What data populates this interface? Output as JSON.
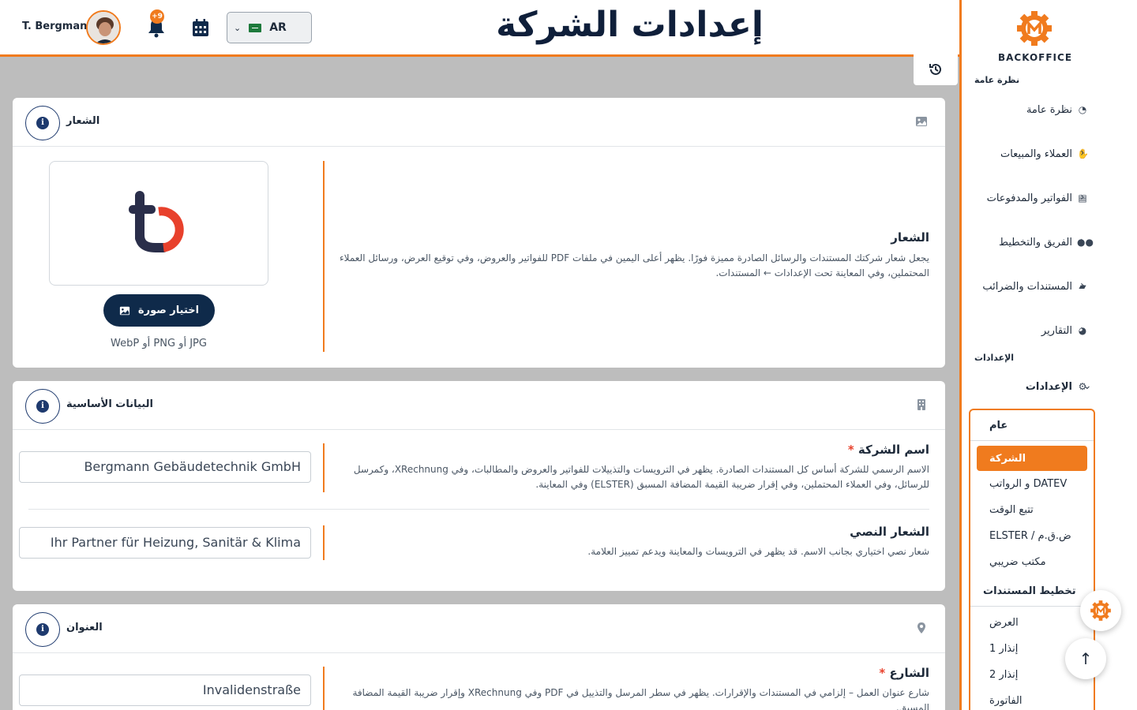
{
  "header": {
    "user_name": "T. Bergmann",
    "notifications_badge": "+9",
    "language": "AR",
    "page_title": "إعدادات الشركة"
  },
  "sidebar": {
    "brand": "BACKOFFICE",
    "section_overview": "نظرة عامة",
    "items": [
      {
        "label": "نظرة عامة",
        "icon": "gauge-icon"
      },
      {
        "label": "العملاء والمبيعات",
        "icon": "handshake-icon"
      },
      {
        "label": "الفواتير والمدفوعات",
        "icon": "invoice-icon"
      },
      {
        "label": "الفريق والتخطيط",
        "icon": "users-icon"
      },
      {
        "label": "المستندات والضرائب",
        "icon": "folder-icon"
      },
      {
        "label": "التقارير",
        "icon": "pie-chart-icon"
      }
    ],
    "section_settings": "الإعدادات",
    "settings_item": {
      "label": "الإعدادات",
      "icon": "gear-icon"
    },
    "subnav": {
      "head_general": "عام",
      "active": "الشركة",
      "items_general": [
        "DATEV و الرواتب",
        "تتبع الوقت",
        "ض.ق.م / ELSTER",
        "مكتب ضريبي"
      ],
      "head_docs": "تخطيط المستندات",
      "items_docs": [
        "العرض",
        "إنذار 1",
        "إنذار 2",
        "الفاتورة"
      ]
    }
  },
  "cards": {
    "logo": {
      "title": "الشعار",
      "field_label": "الشعار",
      "field_desc": "يجعل شعار شركتك المستندات والرسائل الصادرة مميزة فورًا. يظهر أعلى اليمين في ملفات PDF للفواتير والعروض، وفي توقيع العرض، ورسائل العملاء المحتملين، وفي المعاينة تحت الإعدادات ← المستندات.",
      "pick_button": "اختيار صورة",
      "formats": "JPG أو PNG أو WebP"
    },
    "basic": {
      "title": "البيانات الأساسية",
      "company_label": "اسم الشركة",
      "company_desc": "الاسم الرسمي للشركة أساس كل المستندات الصادرة. يظهر في الترويسات والتذييلات للفواتير والعروض والمطالبات، وفي XRechnung، وكمرسل للرسائل، وفي العملاء المحتملين، وفي إقرار ضريبة القيمة المضافة المسبق (ELSTER) وفي المعاينة.",
      "company_value": "Bergmann Gebäudetechnik GmbH",
      "slogan_label": "الشعار النصي",
      "slogan_desc": "شعار نصي اختياري بجانب الاسم. قد يظهر في الترويسات والمعاينة ويدعم تمييز العلامة.",
      "slogan_value": "Ihr Partner für Heizung, Sanitär & Klima"
    },
    "address": {
      "title": "العنوان",
      "street_label": "الشارع",
      "street_desc": "شارع عنوان العمل – إلزامي في المستندات والإقرارات. يظهر في سطر المرسل والتذييل في PDF وفي XRechnung وإقرار ضريبة القيمة المضافة المسبق.",
      "street_value": "Invalidenstraße"
    }
  },
  "colors": {
    "accent": "#f07b1e",
    "navy": "#0f2a4a"
  }
}
